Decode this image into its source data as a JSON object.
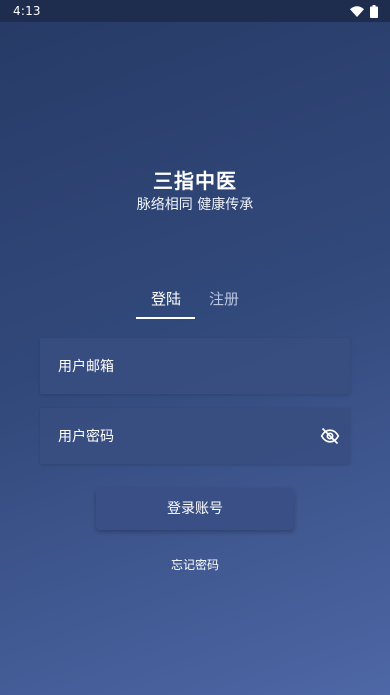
{
  "status_bar": {
    "time": "4:13",
    "icons": [
      "wifi-icon",
      "battery-icon"
    ]
  },
  "brand": {
    "title": "三指中医",
    "subtitle": "脉络相同 健康传承"
  },
  "tabs": [
    {
      "label": "登陆",
      "active": true
    },
    {
      "label": "注册",
      "active": false
    }
  ],
  "form": {
    "email_placeholder": "用户邮箱",
    "password_placeholder": "用户密码",
    "password_toggle_icon": "eye-off-icon"
  },
  "actions": {
    "login_label": "登录账号",
    "forgot_label": "忘记密码"
  },
  "colors": {
    "background_top": "#273a66",
    "background_bottom": "#4e67a6",
    "field_bg": "#384e80",
    "button_bg": "#3a4f85"
  }
}
